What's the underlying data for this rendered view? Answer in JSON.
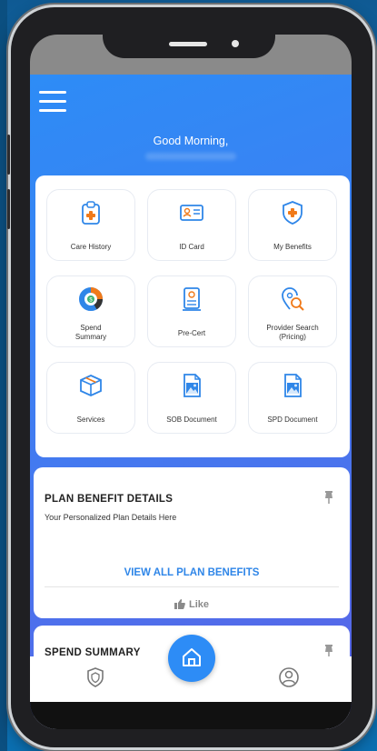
{
  "header": {
    "greeting": "Good Morning,"
  },
  "tiles": [
    {
      "label": "Care History",
      "icon": "clipboard-plus-icon"
    },
    {
      "label": "ID Card",
      "icon": "id-card-icon"
    },
    {
      "label": "My Benefits",
      "icon": "shield-plus-icon"
    },
    {
      "label": "Spend\nSummary",
      "icon": "donut-chart-icon"
    },
    {
      "label": "Pre-Cert",
      "icon": "certificate-icon"
    },
    {
      "label": "Provider Search\n(Pricing)",
      "icon": "location-search-icon"
    },
    {
      "label": "Services",
      "icon": "box-icon"
    },
    {
      "label": "SOB Document",
      "icon": "image-document-icon"
    },
    {
      "label": "SPD Document",
      "icon": "image-document-icon"
    }
  ],
  "plan_card": {
    "title": "PLAN BENEFIT DETAILS",
    "subtitle": "Your Personalized Plan Details Here",
    "view_all": "VIEW ALL PLAN BENEFITS",
    "like": "Like"
  },
  "spend_card": {
    "title": "SPEND SUMMARY"
  },
  "nav": {
    "left_icon": "shield-icon",
    "center_icon": "home-icon",
    "right_icon": "user-icon"
  },
  "colors": {
    "accent": "#2f86e8",
    "gradient_start": "#2d8cf6",
    "gradient_end": "#5b63e6",
    "icon_blue": "#2f86e8",
    "icon_orange": "#f07a1a"
  }
}
